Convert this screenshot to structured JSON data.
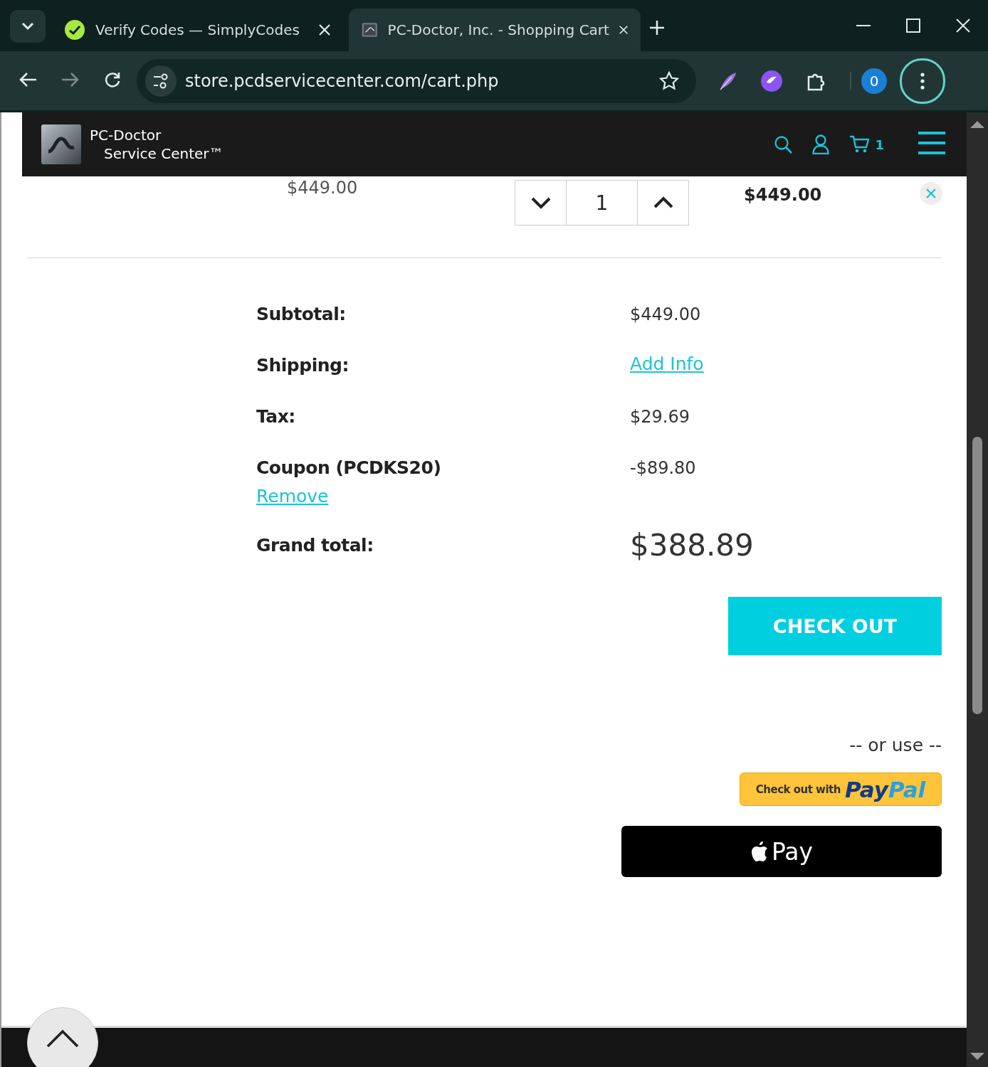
{
  "browser": {
    "tabs": [
      {
        "title": "Verify Codes — SimplyCodes",
        "selected": false
      },
      {
        "title": "PC-Doctor, Inc. - Shopping Cart",
        "selected": true
      }
    ],
    "address": "store.pcdservicecenter.com/cart.php",
    "profile_badge": "0"
  },
  "site_header": {
    "brand_line_1": "PC-Doctor",
    "brand_line_2": "Service Center™",
    "cart_count": "1"
  },
  "cart_item": {
    "unit_price": "$449.00",
    "quantity": "1",
    "line_total": "$449.00"
  },
  "totals": [
    {
      "kind": "amount",
      "label": "Subtotal:",
      "value": "$449.00"
    },
    {
      "kind": "link",
      "label": "Shipping:",
      "value": "Add Info"
    },
    {
      "kind": "amount",
      "label": "Tax:",
      "value": "$29.69"
    },
    {
      "kind": "coupon",
      "label": "Coupon (PCDKS20)",
      "value": "-$89.80",
      "action": "Remove"
    },
    {
      "kind": "grand",
      "label": "Grand total:",
      "value": "$388.89"
    }
  ],
  "checkout_button": "CHECK OUT",
  "alternative_label": "-- or use --",
  "paypal": {
    "label": "Check out with",
    "logo": [
      "Pay",
      "Pal"
    ]
  },
  "apple_pay": "Pay"
}
